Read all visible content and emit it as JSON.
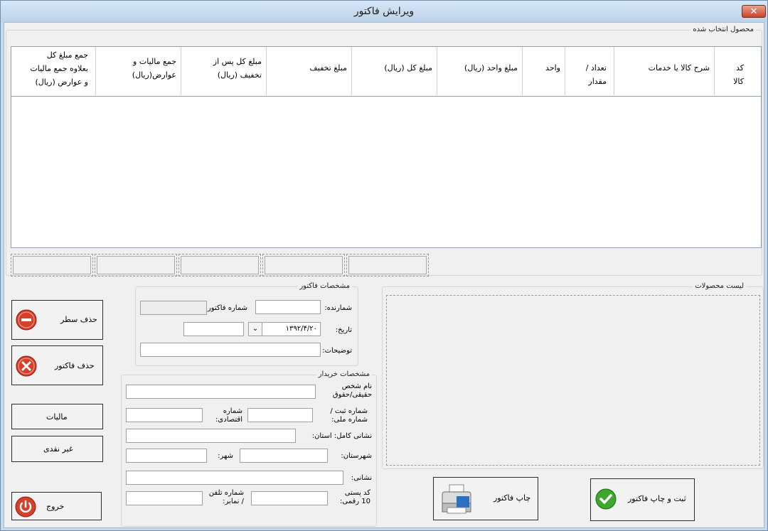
{
  "window": {
    "title": "ویرایش فاکتور",
    "close_label": "✕"
  },
  "products_group": {
    "caption": "محصول انتخاب شده"
  },
  "table": {
    "columns": [
      "کد\nکالا",
      "شرح کالا یا خدمات",
      "تعداد /\nمقدار",
      "واحد",
      "مبلغ واحد (ریال)",
      "مبلغ کل (ریال)",
      "مبلغ تخفیف",
      "مبلغ کل پس از\nتخفیف (ریال)",
      "جمع مالیات و\nعوارض(ریال)",
      "جمع مبلغ کل\nبعلاوه جمع مالیات\nو عوارض (ریال)"
    ]
  },
  "invoice_group": {
    "caption": "مشخصات فاکتور",
    "serial_label": "شمارنده:",
    "serial_value": "",
    "number_label": "شماره فاکتور:",
    "number_value": "",
    "date_label": "تاریخ:",
    "date_value": "۱۳۹۲/۴/۲۰",
    "time_value": "",
    "notes_label": "توضیحات:",
    "notes_value": ""
  },
  "buyer_group": {
    "caption": "مشخصات خریدار",
    "name_label": "نام شخص\nحقیقی/حقوق",
    "reg_label": "شماره ثبت /\nشماره ملی:",
    "econ_label": "شماره\nاقتصادی:",
    "address_label": "نشانی کامل: استان:",
    "county_label": "شهرستان:",
    "city_label": "شهر:",
    "addr_label": "نشانی:",
    "postal_label": "کد پستی\n10 رقمی:",
    "phone_label": "شماره تلفن\n/ نمابر:"
  },
  "products_list": {
    "caption": "لیست محصولات"
  },
  "buttons": {
    "delete_row": "حذف سطر",
    "delete_invoice": "حذف فاکتور",
    "tax": "مالیات",
    "non_cash": "غیر نقدی",
    "exit": "خروج",
    "print": "چاپ فاکتور",
    "save_print": "ثبت و چاپ فاکتور"
  },
  "icons": {
    "delete_row": "minus-circle-icon",
    "delete_invoice": "x-circle-icon",
    "exit": "power-icon",
    "print": "printer-icon",
    "save_print": "check-icon"
  },
  "colors": {
    "titlebar": "#c4d9ee",
    "danger": "#d8402b",
    "ok": "#3fa72c"
  }
}
